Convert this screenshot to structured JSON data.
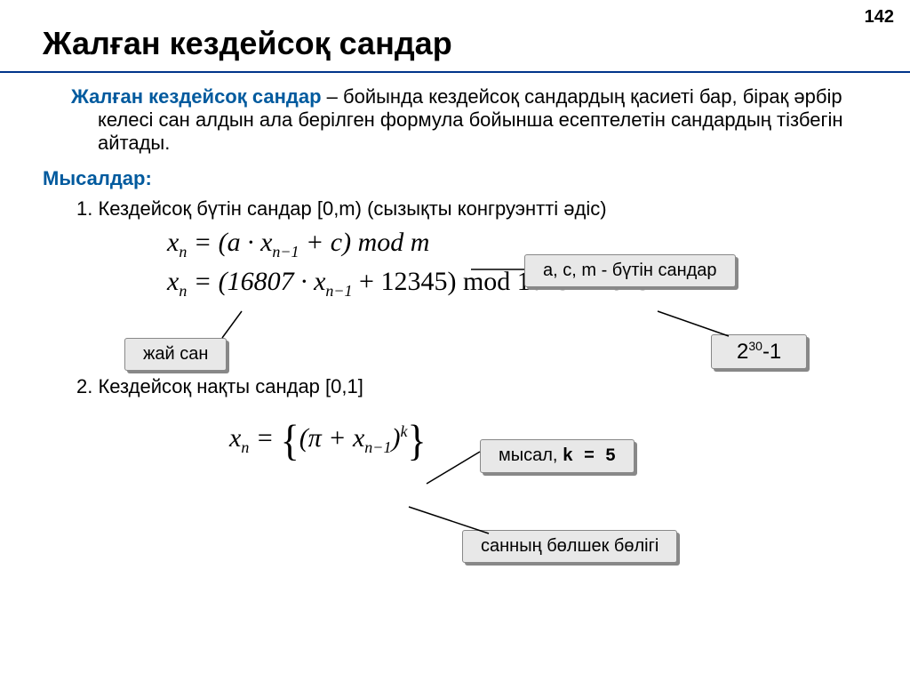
{
  "page_number": "142",
  "title": "Жалған кездейсоқ сандар",
  "definition": {
    "term": "Жалған кездейсоқ сандар",
    "text": " – бойында кездейсоқ сандардың қасиеті бар, бірақ әрбір келесі сан алдын ала берілген формула бойынша есептелетін сандардың тізбегін айтады."
  },
  "examples_label": "Мысалдар:",
  "item1_text": "1.  Кездейсоқ бүтін сандар [0,m) (сызықты конгруэнтті әдіс)",
  "formula1a": {
    "prefix": "x",
    "sub1": "n",
    "eq": " = (a · x",
    "sub2": "n−1",
    "tail": " + c)   mod  ",
    "mvar": "m"
  },
  "formula1b": {
    "prefix": "x",
    "sub1": "n",
    "eq": " = (16807 · x",
    "sub2": "n−1",
    "tail": " + 12345)   mod 1073741823"
  },
  "callout1": "a, c, m - бүтін сандар",
  "callout2": "жай сан",
  "callout3": {
    "base": "2",
    "sup": "30",
    "suffix": "-1"
  },
  "item2_text": "2.  Кездейсоқ нақты сандар [0,1]",
  "formula2": {
    "prefix": "x",
    "sub1": "n",
    "mid_a": " = ",
    "mid_b": "(π + x",
    "sub2": "n−1",
    "tail": ")",
    "sup": "k"
  },
  "callout4": {
    "pre": "мысал,  ",
    "code": "k = 5"
  },
  "callout5": "санның бөлшек бөлігі"
}
